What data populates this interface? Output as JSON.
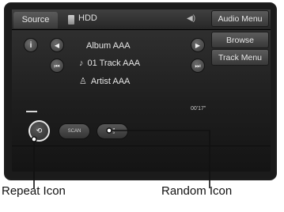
{
  "header": {
    "source_label": "Source",
    "device_label": "HDD"
  },
  "menu": {
    "audio_menu": "Audio Menu",
    "browse": "Browse",
    "track_menu": "Track Menu"
  },
  "track": {
    "album": "Album AAA",
    "title": "01 Track AAA",
    "artist": "Artist AAA",
    "elapsed": "00'17\""
  },
  "controls": {
    "info": "i",
    "scan": "SCAN"
  },
  "callouts": {
    "repeat": "Repeat Icon",
    "random": "Random Icon"
  }
}
